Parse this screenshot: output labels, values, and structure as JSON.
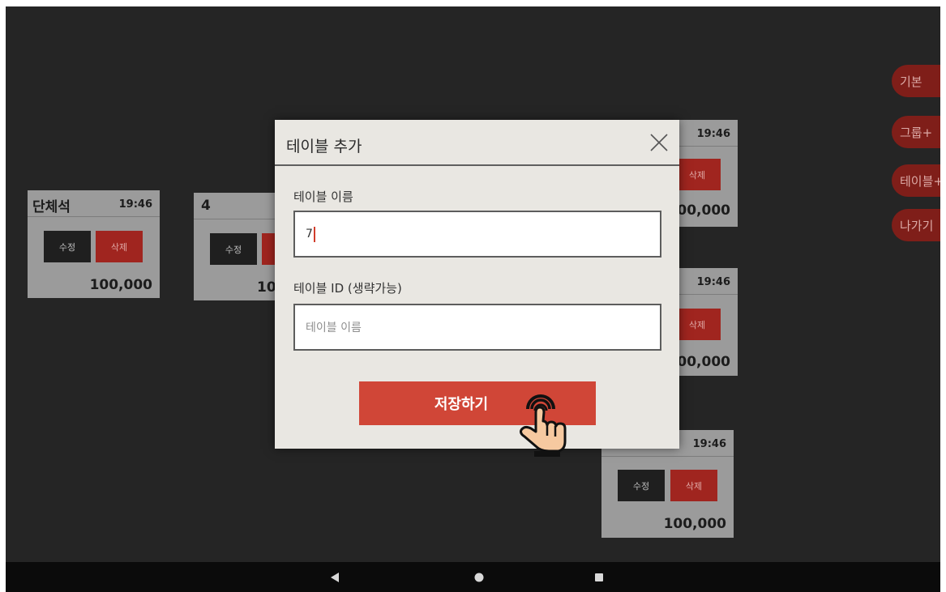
{
  "tables": [
    {
      "name": "단체석",
      "time": "19:46",
      "edit_label": "수정",
      "delete_label": "삭제",
      "price": "100,000"
    },
    {
      "name": "4",
      "time": "",
      "edit_label": "수정",
      "delete_label": "",
      "price": "10"
    },
    {
      "name": "",
      "time": "19:46",
      "edit_label": "",
      "delete_label": "삭제",
      "price": "00,000"
    },
    {
      "name": "",
      "time": "19:46",
      "edit_label": "",
      "delete_label": "삭제",
      "price": "00,000"
    },
    {
      "name": "",
      "time": "19:46",
      "edit_label": "수정",
      "delete_label": "삭제",
      "price": "100,000"
    }
  ],
  "side_menu": {
    "basic": "기본",
    "group_add": "그룹+",
    "table_add": "테이블+",
    "exit": "나가기"
  },
  "dialog": {
    "title": "테이블 추가",
    "name_label": "테이블 이름",
    "name_value": "7",
    "id_label": "테이블 ID (생략가능)",
    "id_placeholder": "테이블 이름",
    "save_label": "저장하기"
  },
  "colors": {
    "accent": "#d04637",
    "delete_button": "#a0251f",
    "side_button": "#7f1e19",
    "background": "#252525",
    "dialog_bg": "#e9e7e2"
  },
  "icons": {
    "close": "close-icon",
    "cursor": "tap-hand-icon",
    "nav_back": "back-triangle-icon",
    "nav_home": "home-circle-icon",
    "nav_recents": "recents-square-icon"
  }
}
